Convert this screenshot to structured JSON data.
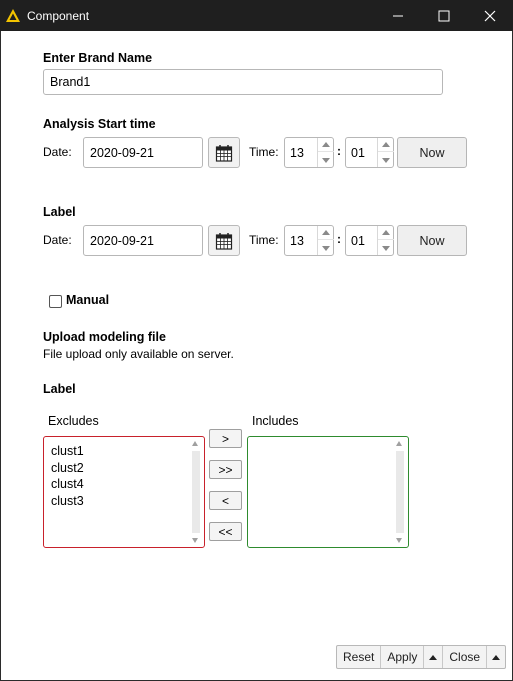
{
  "window": {
    "title": "Component",
    "logo": "knime-triangle-icon",
    "logo_color": "#f2c300"
  },
  "brand": {
    "label": "Enter Brand Name",
    "value": "Brand1"
  },
  "analysis_start": {
    "label": "Analysis Start time",
    "date_label": "Date:",
    "date_value": "2020-09-21",
    "time_label": "Time:",
    "hour": "13",
    "sep": ":",
    "minute": "01",
    "now_label": "Now"
  },
  "label_section": {
    "label": "Label",
    "date_label": "Date:",
    "date_value": "2020-09-21",
    "time_label": "Time:",
    "hour": "13",
    "sep": ":",
    "minute": "01",
    "now_label": "Now"
  },
  "manual": {
    "label": "Manual",
    "checked": false
  },
  "upload": {
    "label": "Upload modeling file",
    "note": "File upload only available on server."
  },
  "filter": {
    "label": "Label",
    "excludes_title": "Excludes",
    "includes_title": "Includes",
    "excludes": [
      "clust1",
      "clust2",
      "clust4",
      "clust3"
    ],
    "includes": [],
    "buttons": {
      "add": ">",
      "add_all": ">>",
      "remove": "<",
      "remove_all": "<<"
    },
    "colors": {
      "excludes_border": "#c8212b",
      "includes_border": "#2e8b2e"
    }
  },
  "footer": {
    "reset": "Reset",
    "apply": "Apply",
    "close": "Close"
  }
}
